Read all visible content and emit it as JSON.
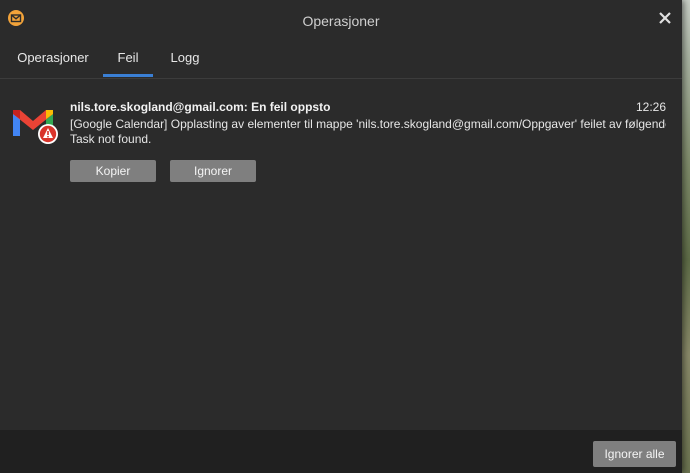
{
  "window": {
    "title": "Operasjoner",
    "app_icon": "em-client-icon",
    "close_icon": "close-icon"
  },
  "tabs": [
    {
      "label": "Operasjoner",
      "active": false
    },
    {
      "label": "Feil",
      "active": true
    },
    {
      "label": "Logg",
      "active": false
    }
  ],
  "accent_color": "#3a7fd4",
  "error_entry": {
    "icon": "gmail-error-icon",
    "heading": "nils.tore.skogland@gmail.com: En feil oppsto",
    "time": "12:26",
    "message_line1": "[Google Calendar] Opplasting av elementer til mappe 'nils.tore.skogland@gmail.com/Oppgaver' feilet av følgende årsak:",
    "message_line2": "Task not found.",
    "copy_label": "Kopier",
    "ignore_label": "Ignorer"
  },
  "footer": {
    "ignore_all_label": "Ignorer alle"
  }
}
